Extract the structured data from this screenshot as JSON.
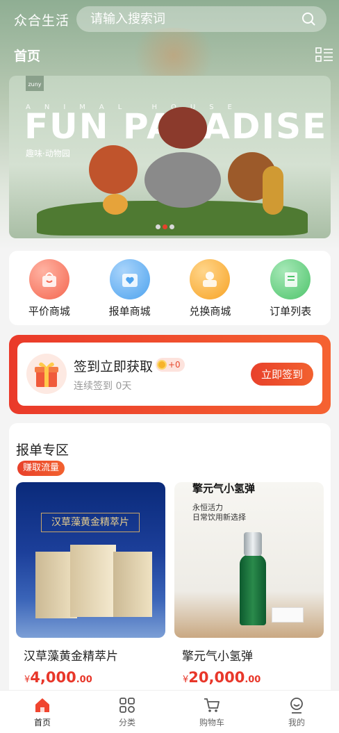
{
  "header": {
    "brand": "众合生活",
    "search_placeholder": "请输入搜索词",
    "page_title": "首页"
  },
  "banner": {
    "logo": "zuny",
    "subtitle": "ANIMAL HOUSE",
    "headline": "FUN PARADISE",
    "tagline": "趣味·动物园",
    "slide_count": 3,
    "active_slide": 1
  },
  "categories": [
    {
      "label": "平价商城",
      "icon": "shop-bag-icon",
      "color": "#f4664f"
    },
    {
      "label": "报单商城",
      "icon": "calendar-heart-icon",
      "color": "#4ea3ee"
    },
    {
      "label": "兑换商城",
      "icon": "coin-exchange-icon",
      "color": "#f7a325"
    },
    {
      "label": "订单列表",
      "icon": "order-list-icon",
      "color": "#4ec46b"
    }
  ],
  "checkin": {
    "title": "签到立即获取",
    "points": "+0",
    "streak": "连续签到 0天",
    "button": "立即签到"
  },
  "zone": {
    "title": "报单专区",
    "tag": "赚取流量",
    "products": [
      {
        "name": "汉草藻黄金精萃片",
        "currency": "¥",
        "price_int": "4,000",
        "price_dec": ".00",
        "image_caption": "汉草藻黄金精萃片"
      },
      {
        "name": "擎元气小氢弹",
        "currency": "¥",
        "price_int": "20,000",
        "price_dec": ".00",
        "image_caption": "擎元气小氢弹",
        "image_sub1": "永恒活力",
        "image_sub2": "日常饮用新选择"
      }
    ]
  },
  "tabbar": [
    {
      "label": "首页",
      "icon": "home-icon",
      "active": true
    },
    {
      "label": "分类",
      "icon": "category-icon",
      "active": false
    },
    {
      "label": "购物车",
      "icon": "cart-icon",
      "active": false
    },
    {
      "label": "我的",
      "icon": "profile-icon",
      "active": false
    }
  ],
  "colors": {
    "accent": "#e8412b",
    "accent2": "#f2612f"
  }
}
